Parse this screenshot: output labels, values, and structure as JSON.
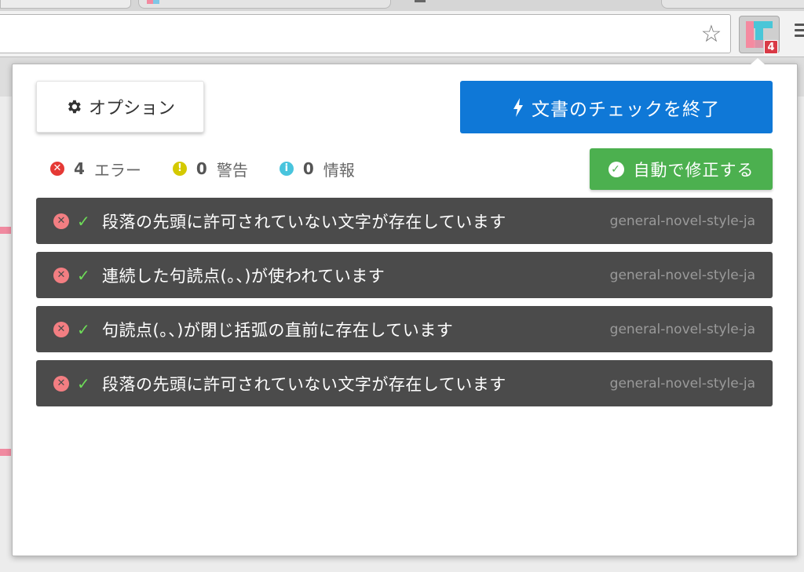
{
  "extension": {
    "badge_count": "4",
    "colors": {
      "badge": "#d93a46",
      "logo_pink": "#f48aa0",
      "logo_teal": "#49c6d8"
    }
  },
  "popup": {
    "options_button": {
      "label": "オプション",
      "icon": "gear-icon"
    },
    "finish_button": {
      "label": "文書のチェックを終了",
      "icon": "bolt-icon",
      "color": "#0f78d7"
    },
    "autofix_button": {
      "label": "自動で修正する",
      "icon": "check-circle-icon",
      "color": "#4cb04f"
    },
    "stats": [
      {
        "count": "4",
        "label": "エラー",
        "icon": "error-icon",
        "color": "#e53935"
      },
      {
        "count": "0",
        "label": "警告",
        "icon": "warning-icon",
        "color": "#d4c900"
      },
      {
        "count": "0",
        "label": "情報",
        "icon": "info-icon",
        "color": "#48c4dd"
      }
    ],
    "issues": [
      {
        "message": "段落の先頭に許可されていない文字が存在しています",
        "rule": "general-novel-style-ja"
      },
      {
        "message": "連続した句読点(。、)が使われています",
        "rule": "general-novel-style-ja"
      },
      {
        "message": "句読点(。、)が閉じ括弧の直前に存在しています",
        "rule": "general-novel-style-ja"
      },
      {
        "message": "段落の先頭に許可されていない文字が存在しています",
        "rule": "general-novel-style-ja"
      }
    ]
  }
}
